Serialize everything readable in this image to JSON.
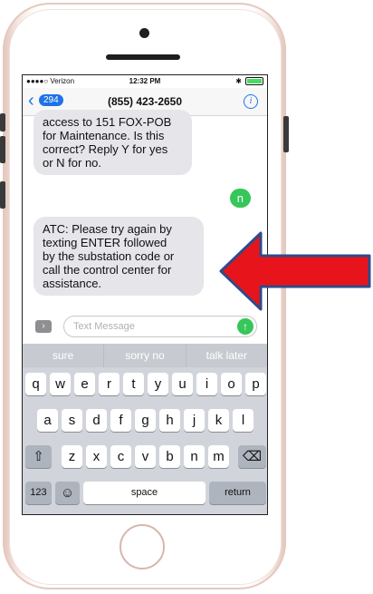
{
  "status_bar": {
    "carrier": "●●●●○ Verizon",
    "time": "12:32 PM",
    "bluetooth": "✱"
  },
  "nav": {
    "back_count": "294",
    "contact": "(855) 423-2650",
    "info": "i"
  },
  "messages": [
    {
      "direction": "incoming",
      "text": "access to 151  FOX-POB\nfor Maintenance. Is this\ncorrect? Reply Y for yes\nor N for no."
    },
    {
      "direction": "outgoing",
      "text": "n"
    },
    {
      "direction": "incoming",
      "text": "ATC: Please try again by\ntexting ENTER followed\nby the substation code or\ncall the control center for\nassistance."
    }
  ],
  "composer": {
    "placeholder": "Text Message"
  },
  "keyboard": {
    "suggestions": [
      "sure",
      "sorry no",
      "talk later"
    ],
    "row1": [
      "q",
      "w",
      "e",
      "r",
      "t",
      "y",
      "u",
      "i",
      "o",
      "p"
    ],
    "row2": [
      "a",
      "s",
      "d",
      "f",
      "g",
      "h",
      "j",
      "k",
      "l"
    ],
    "row3": [
      "z",
      "x",
      "c",
      "v",
      "b",
      "n",
      "m"
    ],
    "numbers_key": "123",
    "space_key": "space",
    "return_key": "return"
  },
  "icons": {
    "back": "chevron-left-icon",
    "info": "info-icon",
    "apps": "chevron-right-icon",
    "send": "arrow-up-icon",
    "shift": "shift-icon",
    "delete": "backspace-icon",
    "emoji": "emoji-icon",
    "annotation": "red-arrow-icon"
  },
  "colors": {
    "accent": "#1e73e8",
    "sent_bubble": "#35c759",
    "received_bubble": "#e5e5ea",
    "annotation_arrow": "#e8141b"
  }
}
